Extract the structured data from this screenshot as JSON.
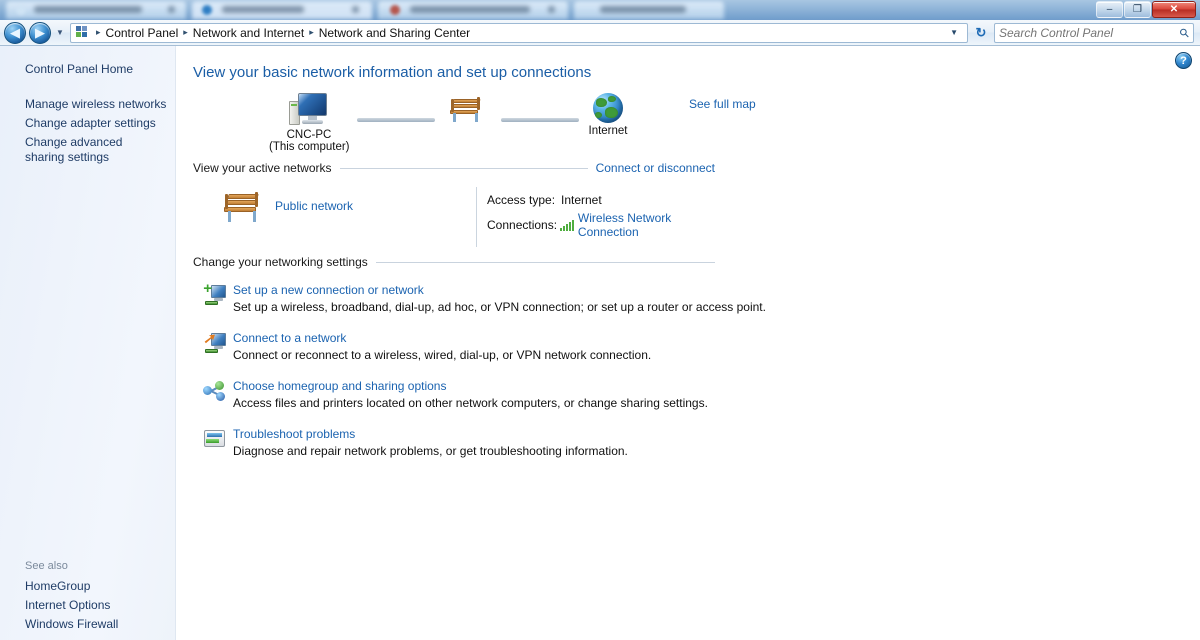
{
  "window": {
    "minimize_label": "–",
    "maximize_label": "❐",
    "close_label": "✕"
  },
  "nav": {
    "back_icon": "◀",
    "forward_icon": "▶",
    "recent_icon": "▼",
    "breadcrumb": [
      {
        "label": "Control Panel"
      },
      {
        "label": "Network and Internet"
      },
      {
        "label": "Network and Sharing Center"
      }
    ],
    "separator": "▸",
    "dropdown_icon": "▼",
    "refresh_icon": "↻",
    "search": {
      "placeholder": "Search Control Panel",
      "value": "",
      "icon": "⚲"
    }
  },
  "help": {
    "label": "?"
  },
  "sidebar": {
    "home_label": "Control Panel Home",
    "items": [
      {
        "label": "Manage wireless networks"
      },
      {
        "label": "Change adapter settings"
      },
      {
        "label": "Change advanced sharing settings"
      }
    ],
    "see_also_label": "See also",
    "see_also_items": [
      {
        "label": "HomeGroup"
      },
      {
        "label": "Internet Options"
      },
      {
        "label": "Windows Firewall"
      }
    ]
  },
  "main": {
    "page_title": "View your basic network information and set up connections",
    "map": {
      "computer_name": "CNC-PC",
      "computer_sublabel": "(This computer)",
      "network_label": "",
      "internet_label": "Internet",
      "see_full_map": "See full map"
    },
    "active_networks": {
      "section_title": "View your active networks",
      "section_action": "Connect or disconnect",
      "network_name": "Public network",
      "access_type_key": "Access type:",
      "access_type_value": "Internet",
      "connections_key": "Connections:",
      "connections_value": "Wireless Network Connection"
    },
    "settings": {
      "section_title": "Change your networking settings",
      "tasks": [
        {
          "title": "Set up a new connection or network",
          "description": "Set up a wireless, broadband, dial-up, ad hoc, or VPN connection; or set up a router or access point."
        },
        {
          "title": "Connect to a network",
          "description": "Connect or reconnect to a wireless, wired, dial-up, or VPN network connection."
        },
        {
          "title": "Choose homegroup and sharing options",
          "description": "Access files and printers located on other network computers, or change sharing settings."
        },
        {
          "title": "Troubleshoot problems",
          "description": "Diagnose and repair network problems, or get troubleshooting information."
        }
      ]
    }
  },
  "colors": {
    "link": "#1b63b0",
    "title": "#1b5ea6",
    "sidebar_link": "#1f3c66",
    "signal_green": "#4fae3f",
    "close_red": "#d9453a"
  }
}
